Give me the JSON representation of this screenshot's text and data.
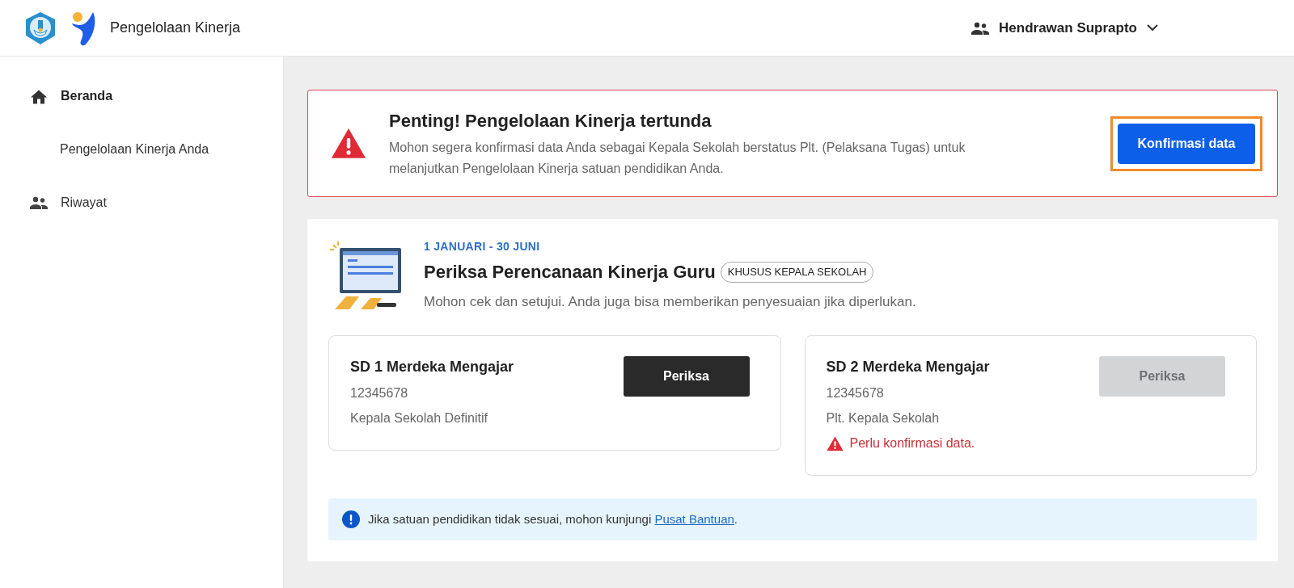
{
  "header": {
    "app_name": "Pengelolaan Kinerja",
    "user_name": "Hendrawan Suprapto"
  },
  "sidebar": {
    "items": [
      {
        "label": "Beranda",
        "kind": "home",
        "selected": true
      },
      {
        "label": "Pengelolaan Kinerja Anda",
        "kind": "subitem",
        "selected": false
      },
      {
        "label": "Riwayat",
        "kind": "history",
        "selected": false
      }
    ]
  },
  "alert": {
    "title": "Penting! Pengelolaan Kinerja tertunda",
    "message": "Mohon segera konfirmasi data Anda sebagai Kepala Sekolah berstatus Plt. (Pelaksana Tugas) untuk melanjutkan Pengelolaan Kinerja satuan pendidikan Anda.",
    "button": "Konfirmasi data",
    "highlighted": true
  },
  "task": {
    "period": "1 JANUARI - 30 JUNI",
    "title": "Periksa Perencanaan Kinerja Guru",
    "badge": "KHUSUS KEPALA SEKOLAH",
    "description": "Mohon cek dan setujui. Anda juga bisa memberikan penyesuaian jika diperlukan.",
    "schools": [
      {
        "name": "SD 1 Merdeka Mengajar",
        "npsn": "12345678",
        "role": "Kepala Sekolah Definitif",
        "button": "Periksa",
        "disabled": false
      },
      {
        "name": "SD 2 Merdeka Mengajar",
        "npsn": "12345678",
        "role": "Plt. Kepala Sekolah",
        "button": "Periksa",
        "disabled": true,
        "warning": "Perlu konfirmasi data."
      }
    ],
    "help": {
      "before": "Jika satuan pendidikan tidak sesuai, mohon kunjungi ",
      "link": "Pusat Bantuan",
      "after": "."
    }
  }
}
